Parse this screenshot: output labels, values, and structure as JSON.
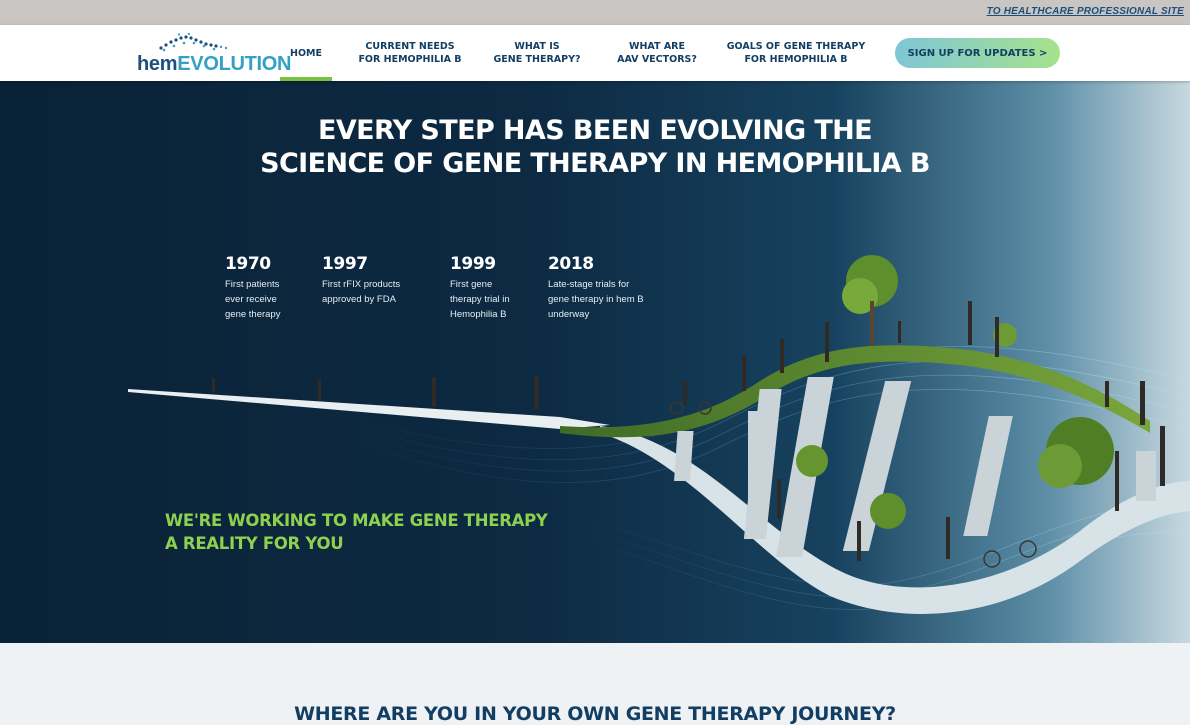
{
  "topbar": {
    "link_label": "TO HEALTHCARE PROFESSIONAL SITE"
  },
  "logo": {
    "part1": "hem",
    "part2": "EVOLUTION"
  },
  "nav": {
    "items": [
      {
        "label": "HOME",
        "active": true
      },
      {
        "label": "CURRENT NEEDS\nFOR HEMOPHILIA B"
      },
      {
        "label": "WHAT IS\nGENE THERAPY?"
      },
      {
        "label": "WHAT ARE\nAAV VECTORS?"
      },
      {
        "label": "GOALS OF GENE THERAPY\nFOR HEMOPHILIA B"
      }
    ],
    "cta_label": "SIGN UP FOR UPDATES >"
  },
  "hero": {
    "title_line1": "EVERY STEP HAS BEEN EVOLVING THE",
    "title_line2": "SCIENCE OF GENE THERAPY IN HEMOPHILIA B",
    "milestones": [
      {
        "year": "1970",
        "text": "First patients\never receive\ngene therapy"
      },
      {
        "year": "1997",
        "text": "First rFIX products\napproved by FDA"
      },
      {
        "year": "1999",
        "text": "First gene\ntherapy trial in\nHemophilia B"
      },
      {
        "year": "2018",
        "text": "Late-stage trials for\ngene therapy in hem B\nunderway"
      }
    ],
    "tagline": "WE'RE WORKING TO MAKE GENE THERAPY\nA REALITY FOR YOU"
  },
  "section2": {
    "title": "WHERE ARE YOU IN YOUR OWN GENE THERAPY JOURNEY?"
  },
  "colors": {
    "navy": "#133e63",
    "accent_green": "#7dc142",
    "hero_bg": "#0b2438",
    "tagline": "#8ed14f"
  }
}
